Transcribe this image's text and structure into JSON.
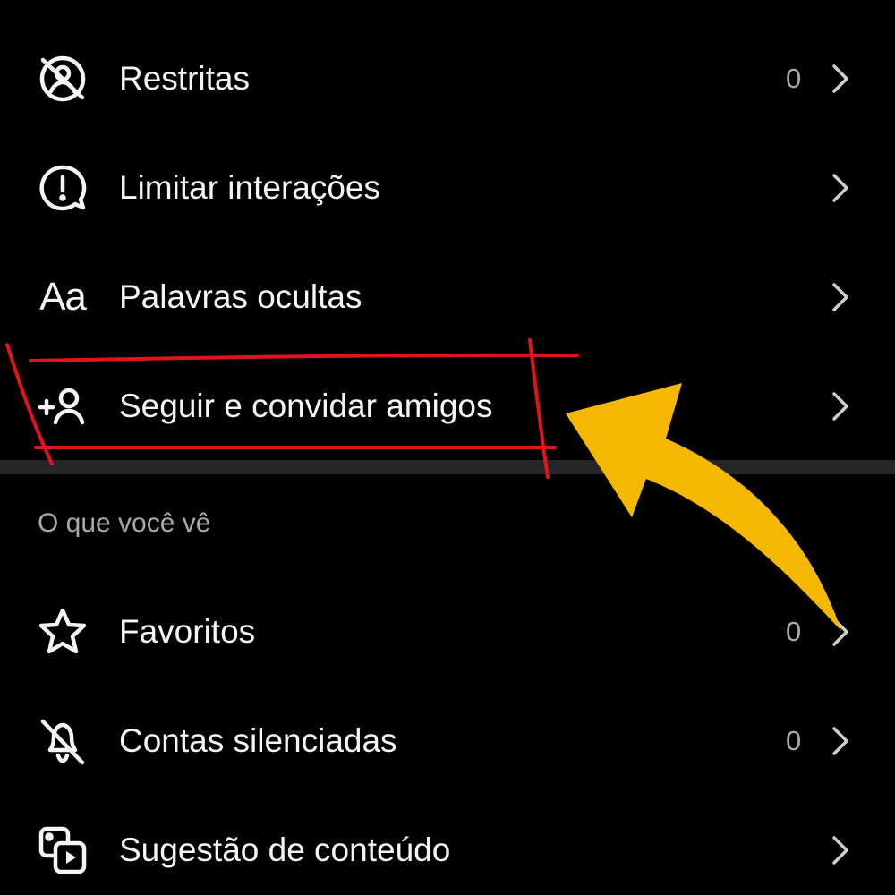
{
  "settings": {
    "items": [
      {
        "label": "Restritas",
        "count": "0",
        "icon": "restrict-icon"
      },
      {
        "label": "Limitar interações",
        "count": "",
        "icon": "limit-interactions-icon"
      },
      {
        "label": "Palavras ocultas",
        "count": "",
        "icon": "text-aa-icon",
        "icon_text": "Aa"
      },
      {
        "label": "Seguir e convidar amigos",
        "count": "",
        "icon": "add-person-icon"
      }
    ],
    "section_header": "O que você vê",
    "section_items": [
      {
        "label": "Favoritos",
        "count": "0",
        "icon": "star-icon"
      },
      {
        "label": "Contas silenciadas",
        "count": "0",
        "icon": "muted-bell-icon"
      },
      {
        "label": "Sugestão de conteúdo",
        "count": "",
        "icon": "content-suggestion-icon"
      }
    ]
  },
  "annotations": {
    "highlight_color": "#e0151c",
    "arrow_color": "#f5b800"
  },
  "colors": {
    "background": "#000000",
    "text": "#f5f5f5",
    "secondary_text": "#a8a8a8",
    "divider": "#262626"
  }
}
